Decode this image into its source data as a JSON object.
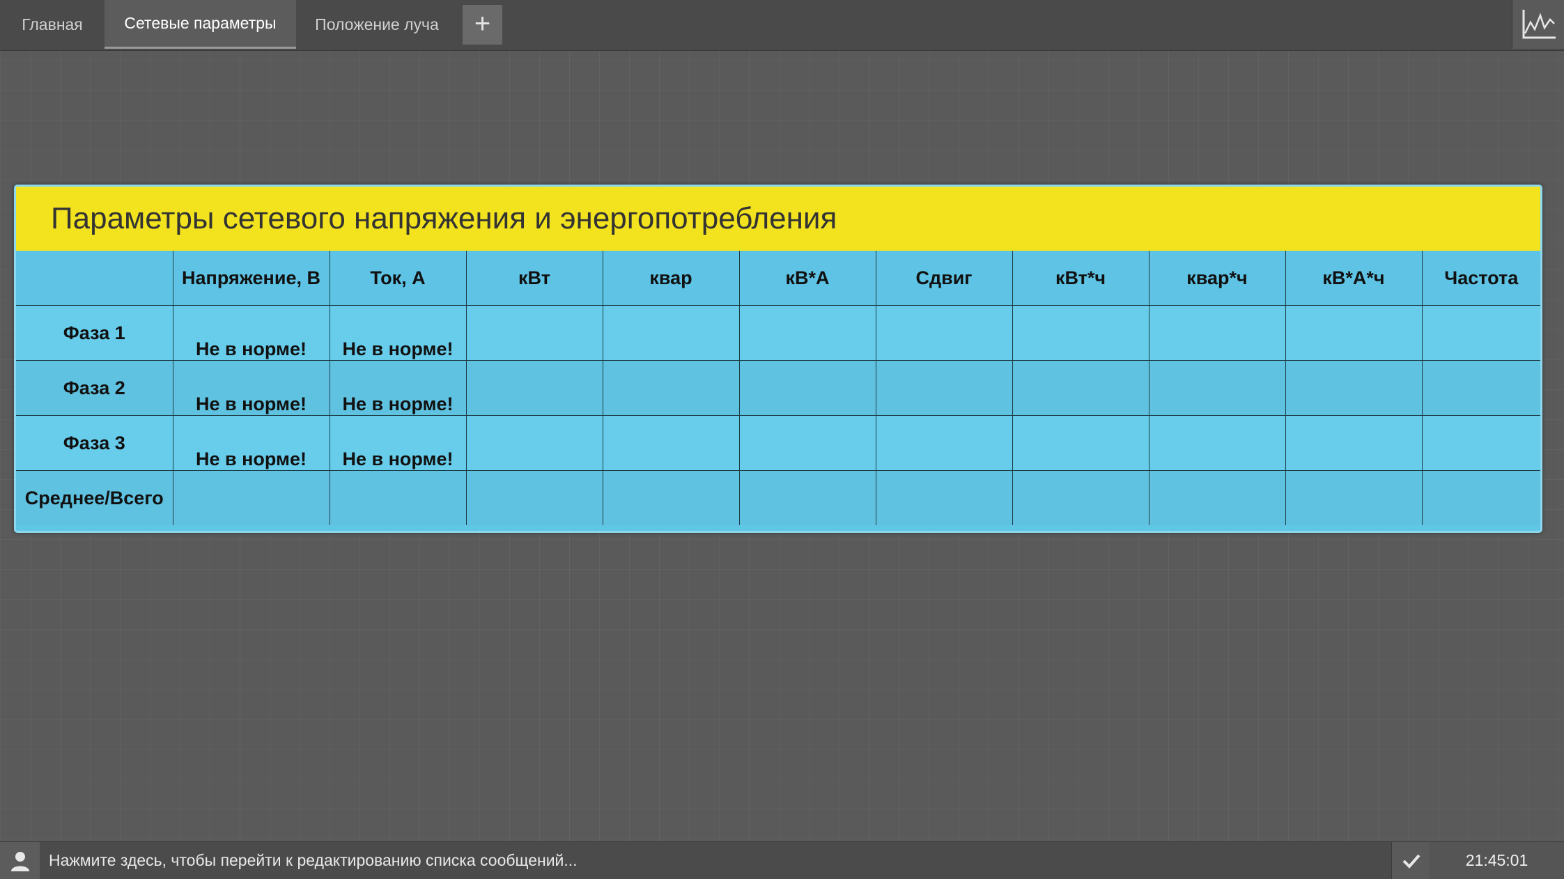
{
  "tabs": {
    "home": "Главная",
    "network": "Сетевые параметры",
    "beam": "Положение луча",
    "add": "+"
  },
  "panel": {
    "title": "Параметры сетевого напряжения и энергопотребления",
    "columns": [
      "Напряжение, В",
      "Ток, А",
      "кВт",
      "квар",
      "кВ*А",
      "Сдвиг",
      "кВт*ч",
      "квар*ч",
      "кВ*А*ч",
      "Частота"
    ],
    "rows": [
      {
        "label": "Фаза 1",
        "voltage": "Не в норме!",
        "current": "Не в норме!"
      },
      {
        "label": "Фаза 2",
        "voltage": "Не в норме!",
        "current": "Не в норме!"
      },
      {
        "label": "Фаза 3",
        "voltage": "Не в норме!",
        "current": "Не в норме!"
      },
      {
        "label": "Среднее/Всего",
        "voltage": "",
        "current": ""
      }
    ]
  },
  "statusbar": {
    "message": "Нажмите здесь, чтобы перейти к редактированию списка сообщений...",
    "time": "21:45:01"
  },
  "icons": {
    "chart": "chart-icon",
    "user": "user-icon",
    "check": "check-icon"
  },
  "colors": {
    "title_bar": "#f3e31f",
    "table_bg": "#5fc6e6",
    "warning_text": "#ffffff"
  }
}
